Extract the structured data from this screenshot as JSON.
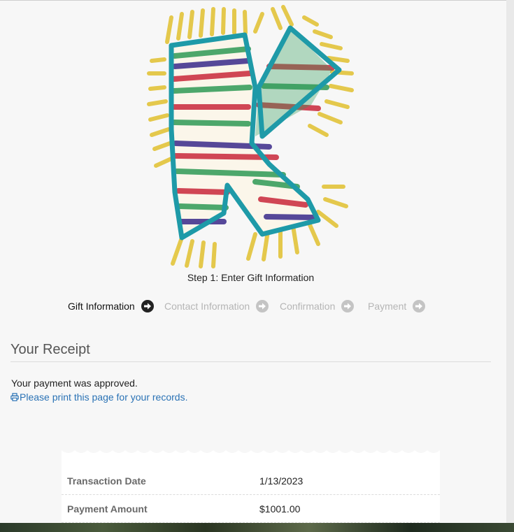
{
  "step_caption": "Step 1: Enter Gift Information",
  "wizard": {
    "steps": [
      {
        "label": "Gift Information",
        "active": true
      },
      {
        "label": "Contact Information",
        "active": false
      },
      {
        "label": "Confirmation",
        "active": false
      },
      {
        "label": "Payment",
        "active": false
      }
    ],
    "icon": "circle-arrow-right-icon"
  },
  "receipt_section": {
    "title": "Your Receipt",
    "approved_message": "Your payment was approved.",
    "print_link": "Please print this page for your records.",
    "print_icon": "printer-icon"
  },
  "receipt": {
    "rows": [
      {
        "label": "Transaction Date",
        "value": "1/13/2023"
      },
      {
        "label": "Payment Amount",
        "value": "$1001.00"
      }
    ]
  },
  "colors": {
    "link": "#2a72b5",
    "active_step": "#111111",
    "inactive_step": "#b5b5b5",
    "muted_label": "#6a6a6a",
    "scarf_border": "#1e9aa8",
    "scarf_fringe": "#e2c43a"
  }
}
